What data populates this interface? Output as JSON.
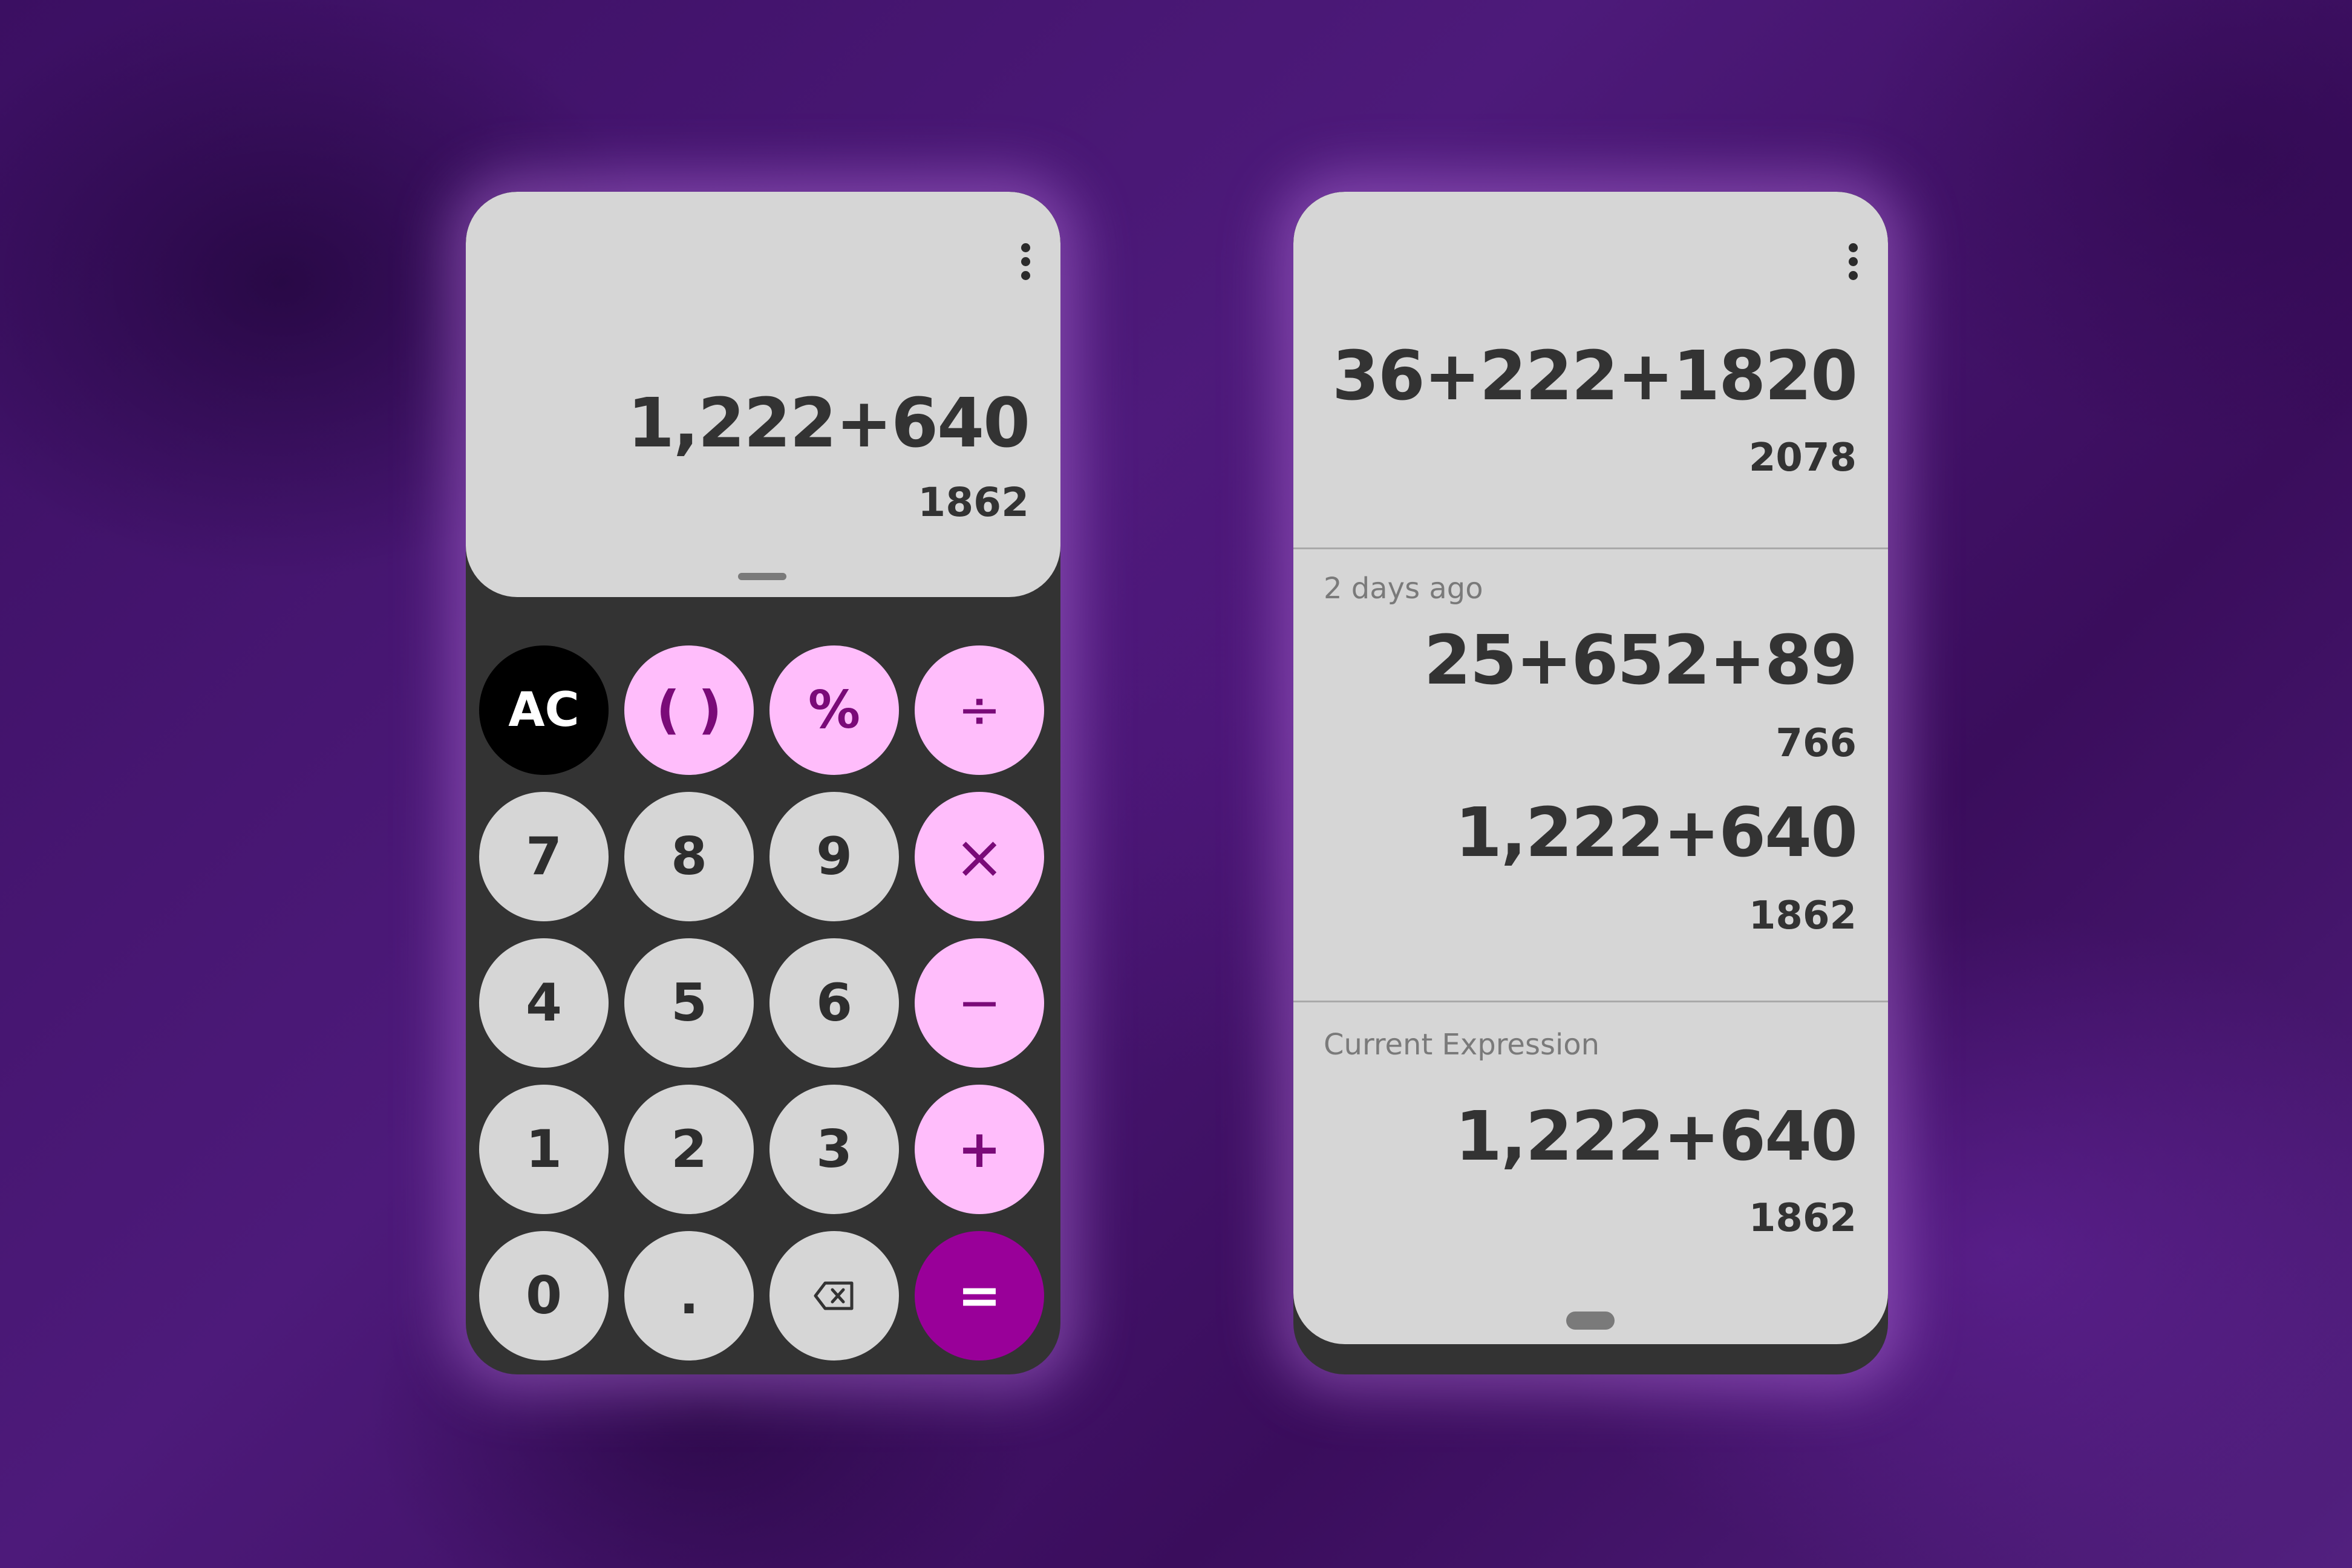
{
  "calculator": {
    "expression": "1,222+640",
    "result": "1862",
    "keys": [
      {
        "label": "AC",
        "type": "ac",
        "name": "clear-button"
      },
      {
        "label": "( )",
        "type": "op",
        "name": "parentheses-button"
      },
      {
        "label": "%",
        "type": "op",
        "name": "percent-button"
      },
      {
        "label": "÷",
        "type": "op",
        "name": "divide-button"
      },
      {
        "label": "7",
        "type": "num",
        "name": "digit-7-button"
      },
      {
        "label": "8",
        "type": "num",
        "name": "digit-8-button"
      },
      {
        "label": "9",
        "type": "num",
        "name": "digit-9-button"
      },
      {
        "label": "×",
        "type": "op",
        "name": "multiply-button",
        "icon": "multiply-icon"
      },
      {
        "label": "4",
        "type": "num",
        "name": "digit-4-button"
      },
      {
        "label": "5",
        "type": "num",
        "name": "digit-5-button"
      },
      {
        "label": "6",
        "type": "num",
        "name": "digit-6-button"
      },
      {
        "label": "−",
        "type": "op",
        "name": "subtract-button"
      },
      {
        "label": "1",
        "type": "num",
        "name": "digit-1-button"
      },
      {
        "label": "2",
        "type": "num",
        "name": "digit-2-button"
      },
      {
        "label": "3",
        "type": "num",
        "name": "digit-3-button"
      },
      {
        "label": "+",
        "type": "op",
        "name": "add-button"
      },
      {
        "label": "0",
        "type": "num",
        "name": "digit-0-button"
      },
      {
        "label": ".",
        "type": "num",
        "name": "decimal-button"
      },
      {
        "label": "",
        "type": "num",
        "name": "backspace-button",
        "icon": "backspace-icon"
      },
      {
        "label": "=",
        "type": "eq",
        "name": "equals-button"
      }
    ]
  },
  "history": {
    "top_entry": {
      "expression": "36+222+1820",
      "result": "2078"
    },
    "older_label": "2 days ago",
    "older_entries": [
      {
        "expression": "25+652+89",
        "result": "766"
      },
      {
        "expression": "1,222+640",
        "result": "1862"
      }
    ],
    "current_label": "Current Expression",
    "current": {
      "expression": "1,222+640",
      "result": "1862"
    }
  },
  "colors": {
    "operator_key": "#ffbdfb",
    "operator_text": "#7a0a78",
    "equals_key": "#990099",
    "number_key": "#d6d6d6",
    "panel_dark": "#333333"
  }
}
